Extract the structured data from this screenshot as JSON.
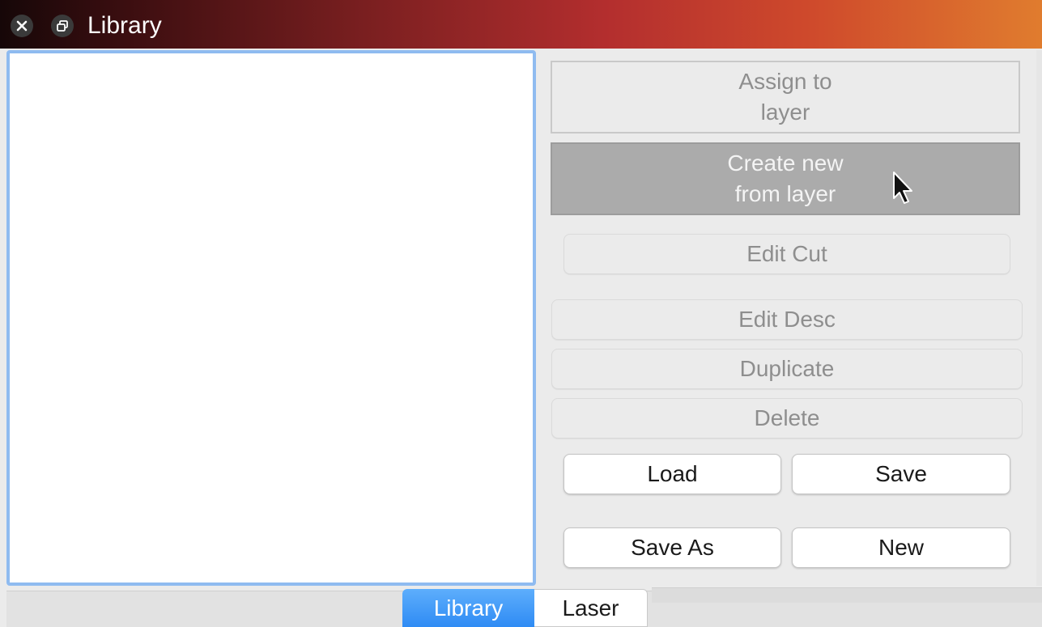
{
  "window": {
    "title": "Library"
  },
  "titlebar": {
    "close_icon": "close-icon",
    "restore_icon": "restore-icon"
  },
  "actions": {
    "assign_line1": "Assign to",
    "assign_line2": "layer",
    "create_line1": "Create new",
    "create_line2": "from layer",
    "edit_cut": "Edit Cut",
    "edit_desc": "Edit Desc",
    "duplicate": "Duplicate",
    "delete": "Delete",
    "load": "Load",
    "save": "Save",
    "save_as": "Save As",
    "new": "New"
  },
  "tabs": [
    {
      "label": "Library",
      "active": true
    },
    {
      "label": "Laser",
      "active": false
    }
  ],
  "colors": {
    "list_focus_border": "#8fbbf0",
    "active_tab": "#2f8bf4",
    "hover_button": "#ababab"
  }
}
